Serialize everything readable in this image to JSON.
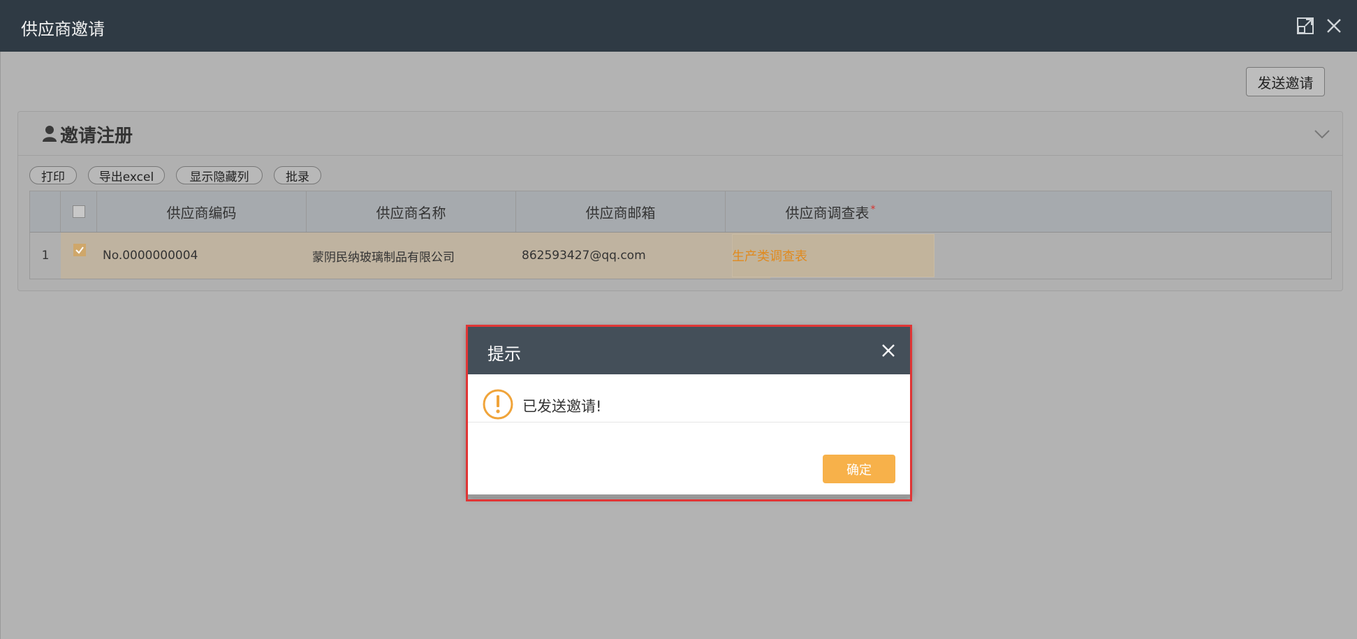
{
  "window": {
    "title": "供应商邀请",
    "maximize_icon": "maximize-icon",
    "close_icon": "close-icon"
  },
  "toolbar": {
    "send_invite_label": "发送邀请"
  },
  "panel": {
    "title": "邀请注册",
    "icon": "user-icon",
    "collapse_icon": "chevron-down-icon",
    "buttons": [
      "打印",
      "导出excel",
      "显示隐藏列",
      "批录"
    ]
  },
  "grid": {
    "columns": [
      "供应商编码",
      "供应商名称",
      "供应商邮箱",
      "供应商调查表"
    ],
    "required_mark": "*",
    "rows": [
      {
        "index": "1",
        "checked": true,
        "code": "No.0000000004",
        "name": "蒙阴民纳玻璃制品有限公司",
        "email": "862593427@qq.com",
        "survey": "生产类调查表"
      }
    ]
  },
  "dialog": {
    "title": "提示",
    "message": "已发送邀请!",
    "ok_label": "确定",
    "icon": "warning-icon"
  },
  "colors": {
    "titlebar": "#2f3a44",
    "dialog_header": "#444f59",
    "ok_button": "#f7b14a",
    "survey_link": "#e08a1e",
    "highlight_outline": "#e03535",
    "required": "#d9302c"
  }
}
